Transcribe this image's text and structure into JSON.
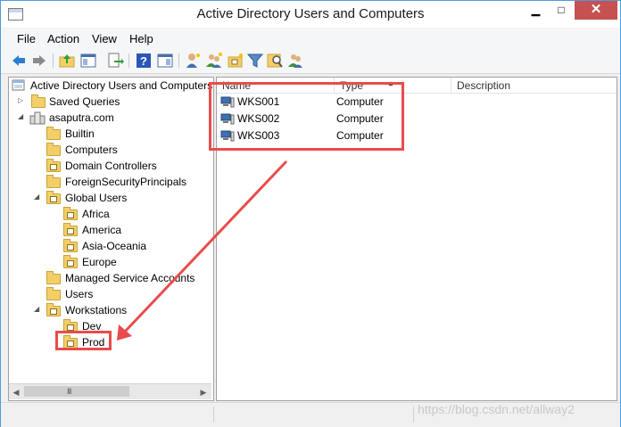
{
  "window": {
    "title": "Active Directory Users and Computers"
  },
  "window_controls": {
    "minimize": "▁",
    "maximize": "□",
    "close": "✕"
  },
  "menu": [
    "File",
    "Action",
    "View",
    "Help"
  ],
  "toolbar": {
    "icons": [
      "back-arrow-icon",
      "forward-arrow-icon",
      "up-folder-icon",
      "show-tree-icon",
      "export-list-icon",
      "help-icon",
      "properties-pane-icon",
      "new-user-icon",
      "new-group-icon",
      "new-ou-icon",
      "filter-icon",
      "find-icon",
      "add-to-group-icon"
    ]
  },
  "tree": {
    "root": "Active Directory Users and Computers [",
    "saved_queries": "Saved Queries",
    "domain": "asaputra.com",
    "items": [
      {
        "label": "Builtin",
        "kind": "folder"
      },
      {
        "label": "Computers",
        "kind": "folder"
      },
      {
        "label": "Domain Controllers",
        "kind": "ou"
      },
      {
        "label": "ForeignSecurityPrincipals",
        "kind": "folder"
      },
      {
        "label": "Global Users",
        "kind": "ou",
        "expanded": true
      },
      {
        "label": "Africa",
        "kind": "ou"
      },
      {
        "label": "America",
        "kind": "ou"
      },
      {
        "label": "Asia-Oceania",
        "kind": "ou"
      },
      {
        "label": "Europe",
        "kind": "ou"
      },
      {
        "label": "Managed Service Accounts",
        "kind": "folder"
      },
      {
        "label": "Users",
        "kind": "folder"
      },
      {
        "label": "Workstations",
        "kind": "ou",
        "expanded": true
      },
      {
        "label": "Dev",
        "kind": "ou"
      },
      {
        "label": "Prod",
        "kind": "ou"
      }
    ]
  },
  "list": {
    "columns": [
      "Name",
      "Type",
      "Description"
    ],
    "rows": [
      {
        "name": "WKS001",
        "type": "Computer"
      },
      {
        "name": "WKS002",
        "type": "Computer"
      },
      {
        "name": "WKS003",
        "type": "Computer"
      }
    ]
  },
  "scrollbar": {
    "grip": "III",
    "left": "◀",
    "right": "▶"
  },
  "watermark": "https://blog.csdn.net/allway2",
  "colors": {
    "highlight": "#e84c4c",
    "close_button": "#c75050",
    "window_border": "#4f9bd9"
  }
}
